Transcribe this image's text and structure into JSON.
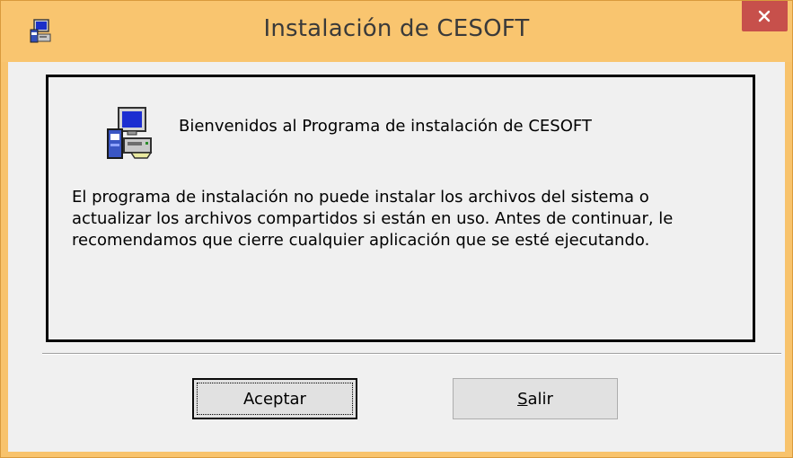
{
  "window": {
    "title": "Instalación de CESOFT",
    "icons": {
      "app": "setup-computer-icon",
      "close": "close-icon"
    },
    "colors": {
      "frame": "#f8c36c",
      "close_button": "#c7504b",
      "client": "#f0f0f0"
    }
  },
  "panel": {
    "welcome": "Bienvenidos al Programa de instalación de CESOFT",
    "message_lines": [
      "El programa de instalación no puede instalar los archivos del sistema o",
      "actualizar los archivos compartidos si están en uso. Antes de continuar, le",
      "recomendamos que cierre cualquier aplicación que se esté ejecutando."
    ],
    "icon": "setup-computer-icon"
  },
  "buttons": {
    "accept": "Aceptar",
    "exit_mnemonic": "S",
    "exit_rest": "alir"
  }
}
